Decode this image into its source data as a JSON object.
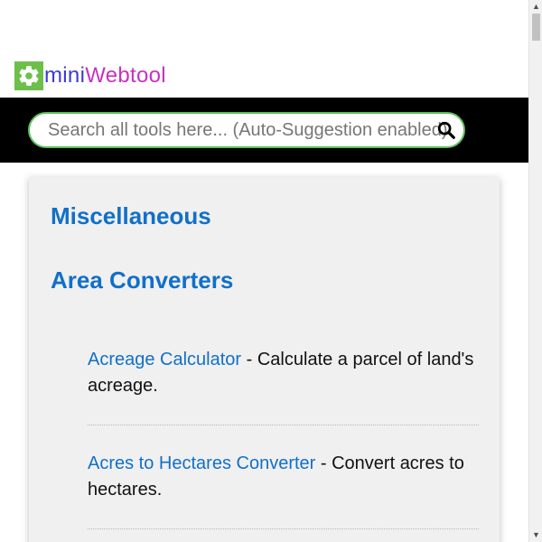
{
  "header": {
    "logo_icon": "gear-icon",
    "logo_part1": "mini",
    "logo_part2": "Webtool"
  },
  "search": {
    "placeholder": "Search all tools here... (Auto-Suggestion enabled)",
    "value": "",
    "icon": "search-icon"
  },
  "content": {
    "category_title": "Miscellaneous",
    "section_title": "Area Converters",
    "tools": [
      {
        "link": "Acreage Calculator",
        "description": " - Calculate a parcel of land's acreage."
      },
      {
        "link": "Acres to Hectares Converter",
        "description": " - Convert acres to hectares."
      }
    ]
  },
  "colors": {
    "brand_green": "#6cc04a",
    "link_blue": "#1170c8",
    "logo_mini": "#3e3ad0",
    "logo_web": "#c832c0",
    "search_border": "#5cc05a"
  }
}
